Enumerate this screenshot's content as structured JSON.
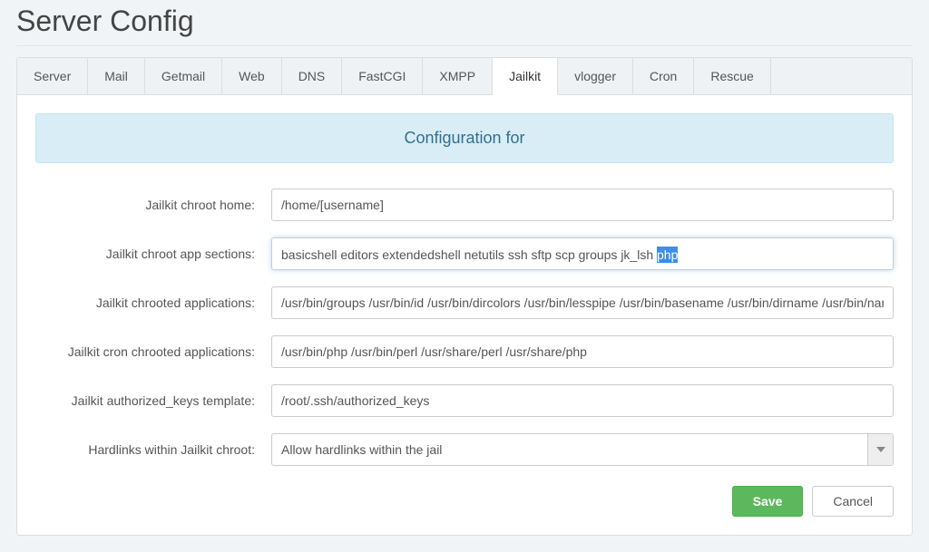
{
  "page_title": "Server Config",
  "tabs": [
    {
      "label": "Server"
    },
    {
      "label": "Mail"
    },
    {
      "label": "Getmail"
    },
    {
      "label": "Web"
    },
    {
      "label": "DNS"
    },
    {
      "label": "FastCGI"
    },
    {
      "label": "XMPP"
    },
    {
      "label": "Jailkit"
    },
    {
      "label": "vlogger"
    },
    {
      "label": "Cron"
    },
    {
      "label": "Rescue"
    }
  ],
  "active_tab": "Jailkit",
  "banner": "Configuration for",
  "fields": {
    "chroot_home": {
      "label": "Jailkit chroot home:",
      "value": "/home/[username]"
    },
    "app_sections": {
      "label": "Jailkit chroot app sections:",
      "value_pre": "basicshell editors extendedshell netutils ssh sftp scp groups jk_lsh ",
      "value_hl": "php"
    },
    "chrooted_apps": {
      "label": "Jailkit chrooted applications:",
      "value": "/usr/bin/groups /usr/bin/id /usr/bin/dircolors /usr/bin/lesspipe /usr/bin/basename /usr/bin/dirname /usr/bin/nano /u"
    },
    "cron_chrooted": {
      "label": "Jailkit cron chrooted applications:",
      "value": "/usr/bin/php /usr/bin/perl /usr/share/perl /usr/share/php"
    },
    "auth_keys": {
      "label": "Jailkit authorized_keys template:",
      "value": "/root/.ssh/authorized_keys"
    },
    "hardlinks": {
      "label": "Hardlinks within Jailkit chroot:",
      "value": "Allow hardlinks within the jail"
    }
  },
  "buttons": {
    "save": "Save",
    "cancel": "Cancel"
  }
}
